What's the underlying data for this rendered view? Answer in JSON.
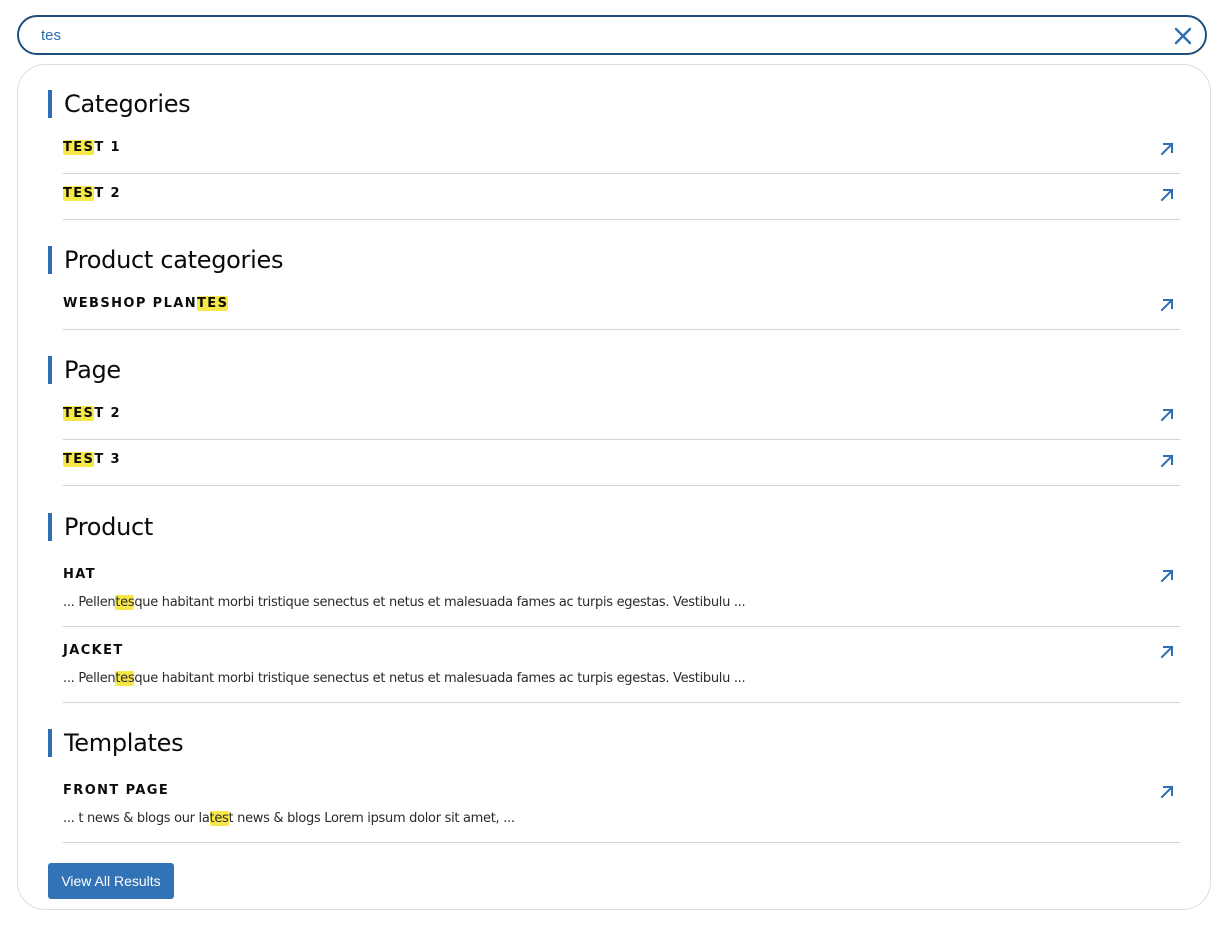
{
  "search": {
    "value": "tes",
    "placeholder": ""
  },
  "sections": [
    {
      "title": "Categories",
      "items": [
        {
          "title": [
            "TES",
            "T 1"
          ],
          "hl": 0
        },
        {
          "title": [
            "TES",
            "T 2"
          ],
          "hl": 0
        }
      ]
    },
    {
      "title": "Product categories",
      "items": [
        {
          "title": [
            "WEBSHOP PLAN",
            "TES"
          ],
          "hl": 1
        }
      ]
    },
    {
      "title": "Page",
      "items": [
        {
          "title": [
            "TES",
            "T 2"
          ],
          "hl": 0
        },
        {
          "title": [
            "TES",
            "T 3"
          ],
          "hl": 0
        }
      ]
    },
    {
      "title": "Product",
      "items": [
        {
          "title": [
            "HAT"
          ],
          "snippet": [
            "... Pellen",
            "tes",
            "que habitant morbi tristique senectus et netus et malesuada fames ac turpis egestas. Vestibulu ..."
          ]
        },
        {
          "title": [
            "JACKET"
          ],
          "snippet": [
            "... Pellen",
            "tes",
            "que habitant morbi tristique senectus et netus et malesuada fames ac turpis egestas. Vestibulu ..."
          ]
        }
      ]
    },
    {
      "title": "Templates",
      "items": [
        {
          "title": [
            "FRONT PAGE"
          ],
          "snippet": [
            "... t news & blogs our la",
            "tes",
            "t news & blogs Lorem ipsum dolor sit amet, ..."
          ]
        }
      ]
    }
  ],
  "view_all_label": "View All Results",
  "colors": {
    "accent": "#2f6fb3",
    "highlight": "#f7e84a",
    "border": "#1f4f7a"
  },
  "icons": {
    "clear": "close-icon",
    "open": "arrow-up-right-icon"
  }
}
